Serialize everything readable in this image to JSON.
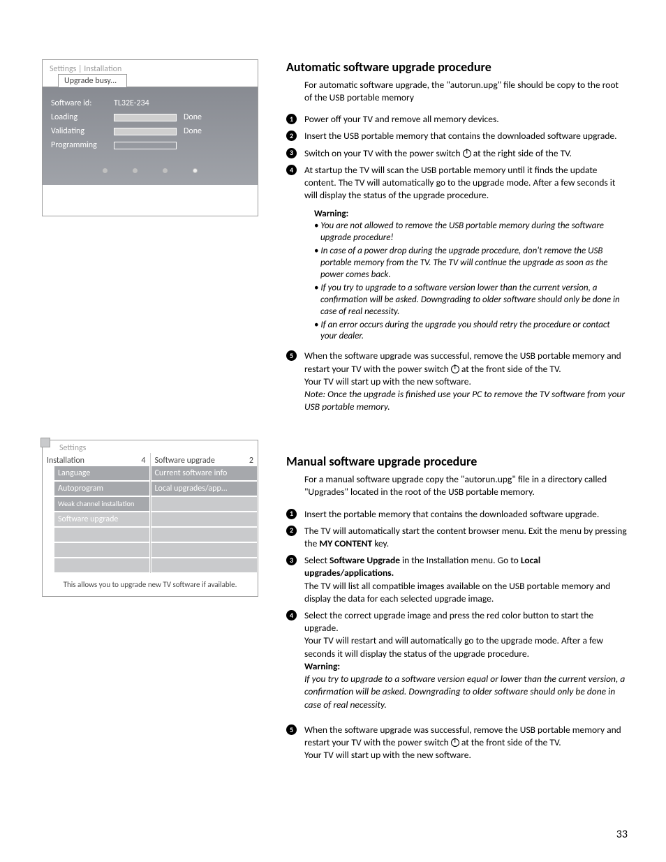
{
  "page_number": "33",
  "figure1": {
    "breadcrumb": "Settings | Installation",
    "tab": "Upgrade busy...",
    "software_id_label": "Software id:",
    "software_id_value": "TL32E-234",
    "row_loading": "Loading",
    "row_validating": "Validating",
    "row_programming": "Programming",
    "done": "Done"
  },
  "figure2": {
    "top": "Settings",
    "left_header": "Installation",
    "left_header_num": "4",
    "right_header": "Software upgrade",
    "right_header_num": "2",
    "left_items": [
      "Language",
      "Autoprogram",
      "Weak channel installation",
      "Software upgrade"
    ],
    "right_items": [
      "Current software info",
      "Local upgrades/app..."
    ],
    "footer": "This allows you to upgrade new TV software if available."
  },
  "section_auto": {
    "title": "Automatic software upgrade procedure",
    "intro": "For automatic software upgrade, the \"autorun.upg\" file should be copy to the root of the USB portable memory",
    "step1": "Power off your TV and remove all memory devices.",
    "step2": "Insert the USB portable memory that contains the downloaded software upgrade.",
    "step3_pre": "Switch on your TV with the power switch ",
    "step3_post": " at the right side of the TV.",
    "step4": "At startup the TV will scan the USB portable memory until it finds the update content. The TV will automatically go to the upgrade mode. After a few seconds it will display the status of the upgrade procedure.",
    "warning_title": "Warning:",
    "warning_items": [
      "You are not allowed to remove the USB portable memory during the software upgrade procedure!",
      "In case of a power drop during the upgrade procedure, don't remove the USB portable memory from the TV. The TV will continue the upgrade as soon as the power comes back.",
      "If you try to upgrade to a software version lower than the current version, a confirmation will be asked. Downgrading to older software should only be done in case of real necessity.",
      "If an error occurs during the upgrade you should retry the procedure or contact your dealer."
    ],
    "step5_a": "When the software upgrade was successful, remove the USB portable memory and restart your TV with the power switch ",
    "step5_b": " at the front side of the TV.",
    "step5_c": "Your TV will start up with the new software.",
    "step5_note": "Note: Once the upgrade is finished use your PC to remove the TV software from your USB portable memory."
  },
  "section_manual": {
    "title": "Manual software upgrade procedure",
    "intro": "For a manual software upgrade copy the \"autorun.upg\" file in a directory called \"Upgrades\" located in the root of the USB portable memory.",
    "step1": "Insert the portable memory that contains the downloaded software upgrade.",
    "step2_a": "The TV will automatically start the content browser menu. Exit the menu by pressing the ",
    "step2_key": "MY CONTENT",
    "step2_b": " key.",
    "step3_a": "Select ",
    "step3_b": "Software Upgrade",
    "step3_c": " in the Installation menu. Go to ",
    "step3_d": "Local upgrades/applications.",
    "step3_tail": "The TV will list all compatible images available on the USB portable memory and display the data for each selected upgrade image.",
    "step4_a": "Select the correct upgrade image and press the red color button to start the upgrade.",
    "step4_b": "Your TV will restart and will automatically go to the upgrade mode. After a few seconds it will display the status of the upgrade procedure.",
    "step4_warn_title": "Warning:",
    "step4_warn": "If you try to upgrade to a software version equal or lower than the current version, a confirmation will be asked. Downgrading to older software should only be done in case of real necessity.",
    "step5_a": "When the software upgrade was successful, remove the USB portable memory and restart your TV with the power switch ",
    "step5_b": " at the front side of the TV.",
    "step5_c": "Your TV will start up with the new software."
  }
}
